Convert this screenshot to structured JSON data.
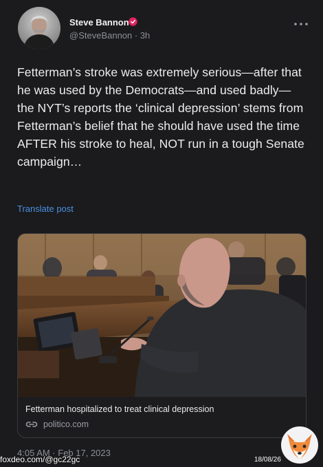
{
  "post": {
    "author_name": "Steve Bannon",
    "handle_time": "@SteveBannon · 3h",
    "text": "Fetterman’s stroke was extremely serious—after that he was used by the Democrats—and used badly— the NYT’s reports the ‘clinical depression’ stems from Fetterman’s belief that he should have used the time AFTER his stroke to heal, NOT run  in a tough Senate campaign…",
    "translate_label": "Translate post",
    "timestamp": "4:05 AM · Feb 17, 2023"
  },
  "link_card": {
    "title": "Fetterman hospitalized to treat clinical depression",
    "domain": "politico.com"
  },
  "watermark": {
    "left_text": "foxdeo.com/@gc22gc",
    "date_text": "18/08/26"
  },
  "colors": {
    "background": "#1b1b1d",
    "link_blue": "#4a90e2",
    "verified_red": "#e0245e",
    "muted_text": "#8b8f96"
  },
  "icons": {
    "verified": "verified-badge-icon",
    "more": "more-options-icon",
    "link": "link-icon",
    "watermark_logo": "fox-logo-icon"
  }
}
